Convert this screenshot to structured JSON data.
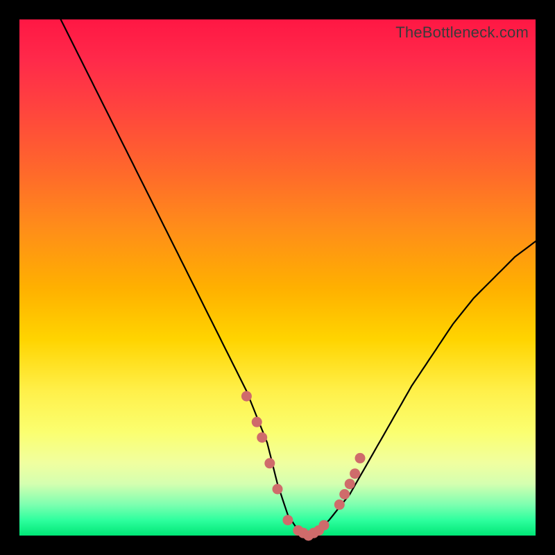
{
  "attribution": "TheBottleneck.com",
  "colors": {
    "background": "#000000",
    "gradient_top": "#ff1744",
    "gradient_mid_orange": "#ff8c1a",
    "gradient_mid_yellow": "#fff04a",
    "gradient_bottom": "#00e676",
    "curve": "#000000",
    "marker_fill": "#cf6b6b",
    "marker_stroke": "#b85a5a"
  },
  "chart_data": {
    "type": "line",
    "title": "",
    "xlabel": "",
    "ylabel": "",
    "xlim": [
      0,
      100
    ],
    "ylim": [
      0,
      100
    ],
    "series": [
      {
        "name": "bottleneck-curve",
        "x": [
          8,
          12,
          16,
          20,
          24,
          28,
          32,
          36,
          40,
          44,
          48,
          50,
          52,
          54,
          56,
          58,
          60,
          64,
          68,
          72,
          76,
          80,
          84,
          88,
          92,
          96,
          100
        ],
        "y": [
          100,
          92,
          84,
          76,
          68,
          60,
          52,
          44,
          36,
          28,
          18,
          10,
          4,
          1,
          0,
          1,
          3,
          8,
          15,
          22,
          29,
          35,
          41,
          46,
          50,
          54,
          57
        ]
      }
    ],
    "markers": {
      "name": "highlight-points",
      "x": [
        44,
        46,
        47,
        48.5,
        50,
        52,
        54,
        55,
        56,
        57,
        58,
        59,
        62,
        63,
        64,
        65,
        66
      ],
      "y": [
        27,
        22,
        19,
        14,
        9,
        3,
        1,
        0.5,
        0,
        0.5,
        1,
        2,
        6,
        8,
        10,
        12,
        15
      ]
    }
  }
}
